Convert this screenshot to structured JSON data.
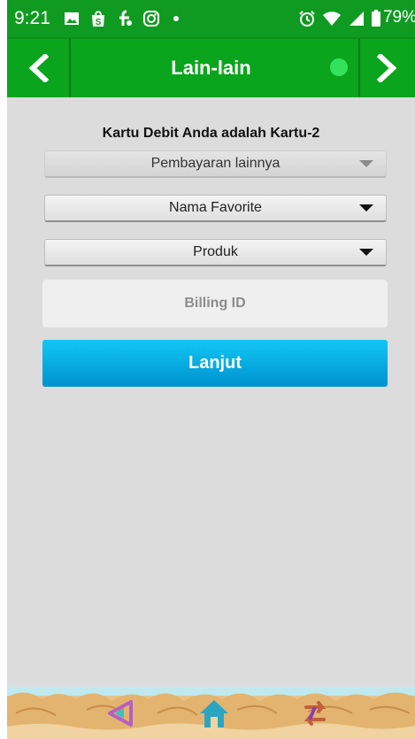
{
  "status_bar": {
    "time": "9:21",
    "battery": "79%",
    "left_icons": [
      "gallery-icon",
      "shop-icon",
      "fontawesome-icon",
      "instagram-icon",
      "dot-icon"
    ],
    "right_icons": [
      "alarm-icon",
      "wifi-icon",
      "signal-icon",
      "battery-icon"
    ]
  },
  "header": {
    "title": "Lain-lain",
    "back_icon": "chevron-left-icon",
    "forward_icon": "chevron-right-icon",
    "indicator_color": "#33e25a",
    "background_color": "#0aa51c"
  },
  "main": {
    "card_label": "Kartu Debit Anda adalah Kartu-2",
    "dropdowns": [
      {
        "label": "Pembayaran lainnya",
        "disabled": true
      },
      {
        "label": "Nama Favorite",
        "disabled": false
      },
      {
        "label": "Produk",
        "disabled": false
      }
    ],
    "billing_placeholder": "Billing ID",
    "billing_value": "",
    "submit_label": "Lanjut",
    "submit_color": "#0aa8e6"
  },
  "bottom_nav": {
    "items": [
      "back-icon",
      "home-icon",
      "transfer-icon"
    ]
  }
}
